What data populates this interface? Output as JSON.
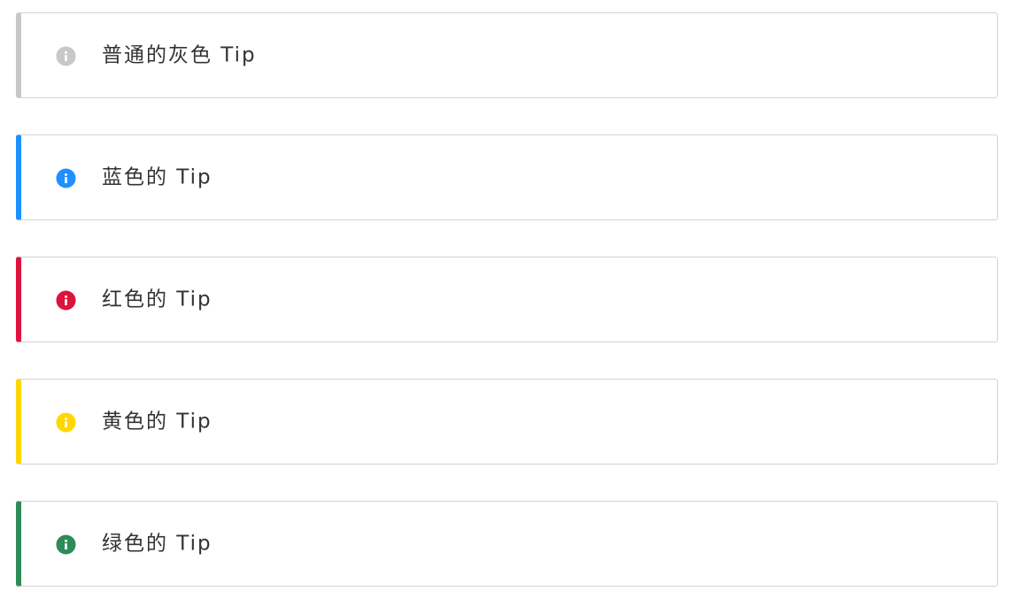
{
  "tips": [
    {
      "text": "普通的灰色 Tip",
      "color": "#c8c8c8",
      "icon": "info-icon"
    },
    {
      "text": "蓝色的 Tip",
      "color": "#1e90ff",
      "icon": "info-icon"
    },
    {
      "text": "红色的 Tip",
      "color": "#dc143c",
      "icon": "info-icon"
    },
    {
      "text": "黄色的 Tip",
      "color": "#ffd700",
      "icon": "info-icon"
    },
    {
      "text": "绿色的 Tip",
      "color": "#2e8b57",
      "icon": "info-icon"
    }
  ]
}
